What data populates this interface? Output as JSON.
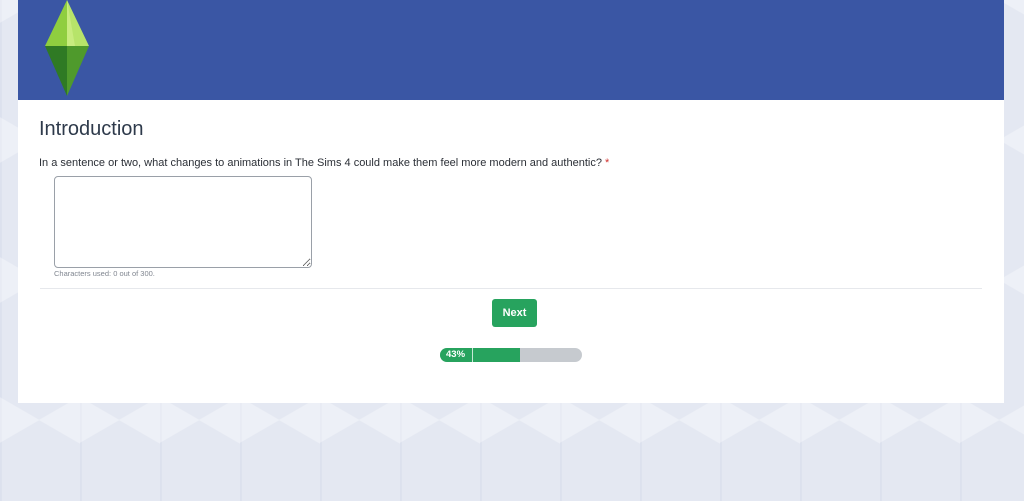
{
  "survey": {
    "section_title": "Introduction",
    "question": "In a sentence or two, what changes to animations in The Sims 4 could make them feel more modern and authentic?",
    "required_marker": "*",
    "answer_value": "",
    "char_counter": "Characters used: 0  out of 300.",
    "next_label": "Next"
  },
  "progress": {
    "label": "43%",
    "fraction": 0.56
  },
  "colors": {
    "banner": "#3a56a4",
    "accent_green": "#27a35e",
    "required_red": "#d0312d"
  },
  "icons": {
    "logo": "plumbob-icon"
  }
}
